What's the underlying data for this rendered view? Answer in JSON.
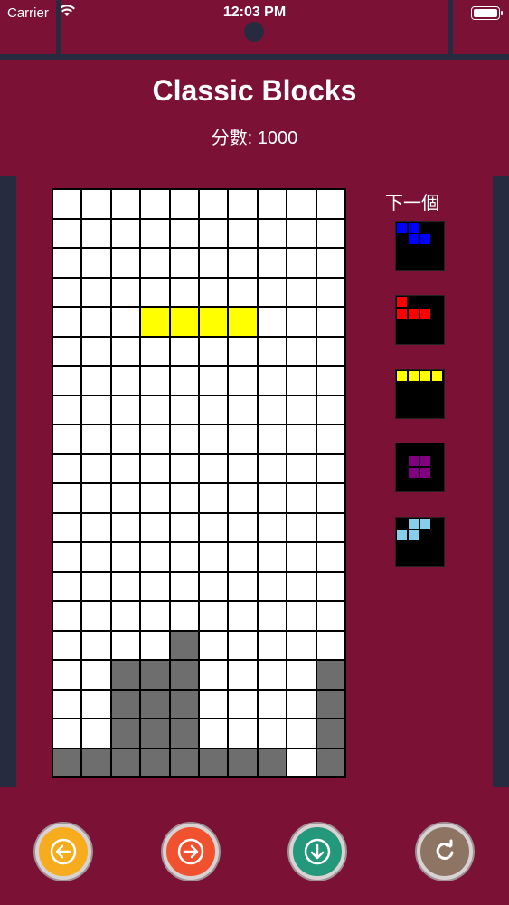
{
  "status": {
    "carrier": "Carrier",
    "time": "12:03 PM"
  },
  "header": {
    "title": "Classic Blocks",
    "score": "分數: 1000"
  },
  "next_label": "下一個",
  "colors": {
    "background": "#7b1135",
    "frame": "#272b3f",
    "empty": "#ffffff",
    "locked": "#6e6e6e"
  },
  "board": {
    "cols": 10,
    "rows": 20,
    "active_piece": {
      "color": "#ffff00",
      "cells": [
        [
          4,
          3
        ],
        [
          4,
          4
        ],
        [
          4,
          5
        ],
        [
          4,
          6
        ]
      ]
    },
    "locked_cells": [
      [
        15,
        4
      ],
      [
        16,
        2
      ],
      [
        16,
        3
      ],
      [
        16,
        4
      ],
      [
        16,
        9
      ],
      [
        17,
        2
      ],
      [
        17,
        3
      ],
      [
        17,
        4
      ],
      [
        17,
        9
      ],
      [
        18,
        2
      ],
      [
        18,
        3
      ],
      [
        18,
        4
      ],
      [
        18,
        9
      ],
      [
        19,
        0
      ],
      [
        19,
        1
      ],
      [
        19,
        2
      ],
      [
        19,
        3
      ],
      [
        19,
        4
      ],
      [
        19,
        5
      ],
      [
        19,
        6
      ],
      [
        19,
        7
      ],
      [
        19,
        9
      ]
    ]
  },
  "next_pieces": [
    {
      "name": "z",
      "color": "#0000ff",
      "cells": [
        [
          0,
          0
        ],
        [
          0,
          1
        ],
        [
          1,
          1
        ],
        [
          1,
          2
        ]
      ]
    },
    {
      "name": "j",
      "color": "#ff0000",
      "cells": [
        [
          0,
          0
        ],
        [
          1,
          0
        ],
        [
          1,
          1
        ],
        [
          1,
          2
        ]
      ]
    },
    {
      "name": "i",
      "color": "#ffff00",
      "cells": [
        [
          0,
          0
        ],
        [
          0,
          1
        ],
        [
          0,
          2
        ],
        [
          0,
          3
        ]
      ]
    },
    {
      "name": "o",
      "color": "#800080",
      "cells": [
        [
          1,
          1
        ],
        [
          1,
          2
        ],
        [
          2,
          1
        ],
        [
          2,
          2
        ]
      ]
    },
    {
      "name": "s",
      "color": "#87ceeb",
      "cells": [
        [
          0,
          1
        ],
        [
          0,
          2
        ],
        [
          1,
          0
        ],
        [
          1,
          1
        ]
      ]
    }
  ],
  "controls": [
    {
      "name": "move-left",
      "icon": "arrow-left-icon",
      "color": "#f6ac1c"
    },
    {
      "name": "move-right",
      "icon": "arrow-right-icon",
      "color": "#f0522f"
    },
    {
      "name": "drop-down",
      "icon": "arrow-down-icon",
      "color": "#23987a"
    },
    {
      "name": "rotate",
      "icon": "rotate-icon",
      "color": "#8e7563"
    }
  ]
}
